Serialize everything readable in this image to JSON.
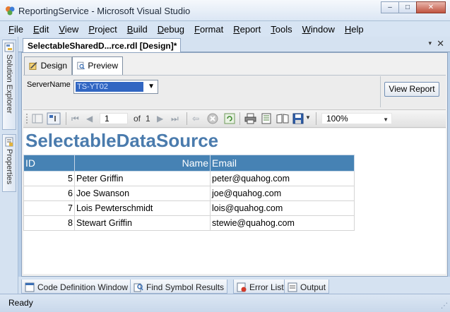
{
  "window": {
    "title": "ReportingService - Microsoft Visual Studio",
    "minimize": "–",
    "maximize": "□",
    "close": "✕"
  },
  "menu": [
    {
      "first": "F",
      "rest": "ile"
    },
    {
      "first": "E",
      "rest": "dit"
    },
    {
      "first": "V",
      "rest": "iew"
    },
    {
      "first": "P",
      "rest": "roject"
    },
    {
      "first": "B",
      "rest": "uild"
    },
    {
      "first": "D",
      "rest": "ebug"
    },
    {
      "first": "F",
      "rest": "ormat"
    },
    {
      "first": "R",
      "rest": "eport"
    },
    {
      "first": "T",
      "rest": "ools"
    },
    {
      "first": "W",
      "rest": "indow"
    },
    {
      "first": "H",
      "rest": "elp"
    }
  ],
  "side_panels": {
    "solution_explorer": "Solution Explorer",
    "properties": "Properties"
  },
  "document": {
    "tab_title": "SelectableSharedD...rce.rdl [Design]*",
    "dropdown_glyph": "▾",
    "close_glyph": "✕",
    "design_tab": "Design",
    "preview_tab": "Preview"
  },
  "parameters": {
    "server_label": "ServerName",
    "server_value": "TS-YT02",
    "view_report": "View Report"
  },
  "toolbar": {
    "page_current": "1",
    "page_of": "of",
    "page_total": "1",
    "zoom": "100%"
  },
  "report": {
    "title": "SelectableDataSource",
    "columns": [
      "ID",
      "Name",
      "Email"
    ],
    "rows": [
      {
        "id": "5",
        "name": "Peter Griffin",
        "email": "peter@quahog.com"
      },
      {
        "id": "6",
        "name": "Joe Swanson",
        "email": "joe@quahog.com"
      },
      {
        "id": "7",
        "name": "Lois Pewterschmidt",
        "email": "lois@quahog.com"
      },
      {
        "id": "8",
        "name": "Stewart Griffin",
        "email": "stewie@quahog.com"
      }
    ]
  },
  "bottom_tabs": {
    "code_definition": "Code Definition Window",
    "find_symbol": "Find Symbol Results",
    "error_list": "Error List",
    "output": "Output"
  },
  "status": {
    "text": "Ready"
  },
  "colors": {
    "report_title": "#4a7bad",
    "table_header": "#4682b4",
    "selection": "#3166c2"
  }
}
